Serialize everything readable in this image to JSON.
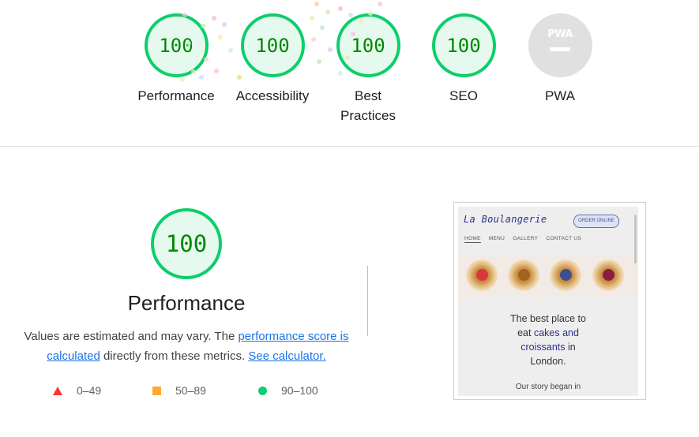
{
  "gauges": [
    {
      "label": "Performance",
      "score": "100"
    },
    {
      "label": "Accessibility",
      "score": "100"
    },
    {
      "label": "Best Practices",
      "score": "100"
    },
    {
      "label": "SEO",
      "score": "100"
    },
    {
      "label": "PWA",
      "badge_text": "PWA"
    }
  ],
  "performance": {
    "score": "100",
    "title": "Performance",
    "desc_before": "Values are estimated and may vary. The ",
    "desc_link": "performance score is calculated",
    "desc_middle": " directly from these metrics. ",
    "desc_calc_link": "See calculator."
  },
  "legend": [
    {
      "range": "0–49",
      "color": "#ff3333"
    },
    {
      "range": "50–89",
      "color": "#ffaa33"
    },
    {
      "range": "90–100",
      "color": "#0cce6b"
    }
  ],
  "screenshot": {
    "logo": "La Boulangerie",
    "order_button": "ORDER ONLINE",
    "nav": [
      "HOME",
      "MENU",
      "GALLERY",
      "CONTACT US"
    ],
    "headline_1": "The best place to",
    "headline_2a": "eat ",
    "headline_2b": "cakes and",
    "headline_3": "croissants",
    "headline_3b": " in",
    "headline_4": "London.",
    "story": "Our story began in"
  },
  "colors": {
    "pass": "#0cce6b",
    "pass_bg": "#e6f9ef",
    "pass_text": "#008800",
    "link": "#1a73e8"
  }
}
